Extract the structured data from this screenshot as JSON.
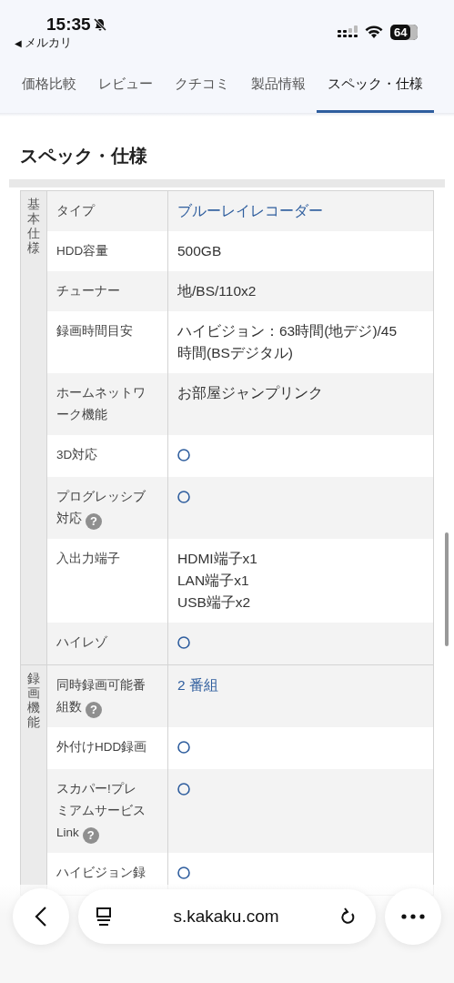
{
  "status_bar": {
    "time": "15:35",
    "back_arrow": "◀",
    "back_label": "メルカリ",
    "battery": "64"
  },
  "tabs": [
    {
      "label": "価格比較",
      "selected": false
    },
    {
      "label": "レビュー",
      "selected": false
    },
    {
      "label": "クチコミ",
      "selected": false
    },
    {
      "label": "製品情報",
      "selected": false
    },
    {
      "label": "スペック・仕様",
      "selected": true
    }
  ],
  "heading": "スペック・仕様",
  "spec_groups": [
    {
      "name": "基本仕様",
      "rows": [
        {
          "label": "タイプ",
          "kind": "link",
          "value": "ブルーレイレコーダー"
        },
        {
          "label": "HDD容量",
          "kind": "text",
          "value": "500GB"
        },
        {
          "label": "チューナー",
          "kind": "text",
          "value": "地/BS/110x2"
        },
        {
          "label": "録画時間目安",
          "kind": "text",
          "value": "ハイビジョン：63時間(地デジ)/45時間(BSデジタル)"
        },
        {
          "label": "ホームネットワーク機能",
          "kind": "text",
          "value": "お部屋ジャンプリンク"
        },
        {
          "label": "3D対応",
          "kind": "circle"
        },
        {
          "label": "プログレッシブ対応",
          "help": "?",
          "kind": "circle"
        },
        {
          "label": "入出力端子",
          "kind": "lines",
          "lines": [
            "HDMI端子x1",
            "LAN端子x1",
            "USB端子x2"
          ]
        },
        {
          "label": "ハイレゾ",
          "kind": "circle"
        }
      ]
    },
    {
      "name": "録画機能",
      "rows": [
        {
          "label": "同時録画可能番組数",
          "help": "?",
          "kind": "link",
          "value": "2 番組"
        },
        {
          "label": "外付けHDD録画",
          "kind": "circle"
        },
        {
          "label": "スカパー!プレミアムサービスLink",
          "help": "?",
          "kind": "circle"
        },
        {
          "label": "ハイビジョン録",
          "kind": "circle"
        }
      ]
    }
  ],
  "browser_bar": {
    "url": "s.kakaku.com"
  }
}
